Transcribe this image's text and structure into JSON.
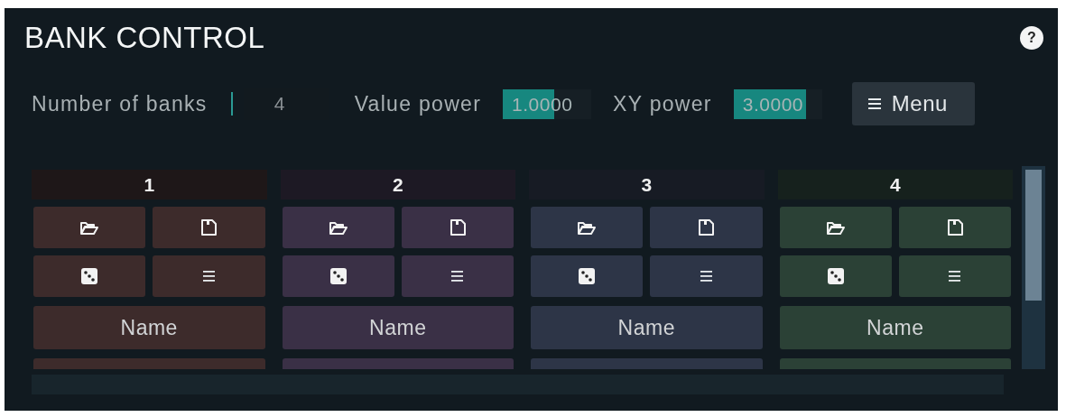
{
  "title": "BANK CONTROL",
  "help_button": {
    "label": "?"
  },
  "controls": [
    {
      "kind": "number",
      "label": "Number of banks",
      "value": "4"
    },
    {
      "kind": "slider",
      "label": "Value power",
      "value": "1.0000",
      "level": 0.58
    },
    {
      "kind": "slider",
      "label": "XY power",
      "value": "3.0000",
      "level": 0.82
    }
  ],
  "menu_button": {
    "label": "Menu"
  },
  "banks": [
    {
      "label": "1",
      "color": "#3d2b2b",
      "name_button": "Name"
    },
    {
      "label": "2",
      "color": "#3a3046",
      "name_button": "Name"
    },
    {
      "label": "3",
      "color": "#2d3547",
      "name_button": "Name"
    },
    {
      "label": "4",
      "color": "#2b4136",
      "name_button": "Name"
    }
  ]
}
